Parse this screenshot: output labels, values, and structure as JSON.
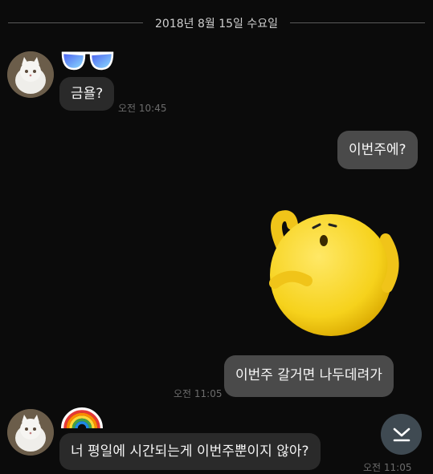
{
  "date_divider": "2018년 8월 15일 수요일",
  "messages": [
    {
      "text": "금욜?",
      "time": "오전 10:45"
    },
    {
      "text": "이번주에?"
    },
    {
      "text": "이번주 갈거면 나두데려가",
      "time": "오전 11:05"
    },
    {
      "text": "너 평일에 시간되는게 이번주뿐이지 않아?",
      "time": "오전 11:05"
    }
  ],
  "icons": {
    "sunglasses": "sunglasses-icon",
    "rainbow": "rainbow-icon",
    "sticker": "yellow-ball-character-sticker",
    "scroll": "chevron-down-icon"
  },
  "colors": {
    "background": "#0b0b0b",
    "incoming_bubble": "#2a2a2a",
    "outgoing_bubble": "#4a4a4a",
    "scroll_button": "#3f4a52",
    "sticker_yellow": "#f6d21c"
  }
}
